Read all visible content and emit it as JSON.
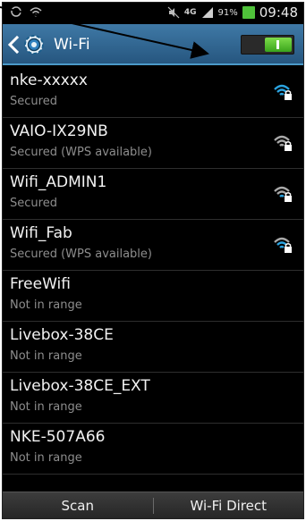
{
  "status_bar": {
    "network_type": "4G",
    "battery_percent": "91%",
    "time": "09:48",
    "icons": [
      "signal-icon",
      "wifi-status-icon",
      "mute-icon",
      "battery-icon"
    ]
  },
  "action_bar": {
    "title": "Wi-Fi",
    "toggle_on": true
  },
  "networks": [
    {
      "name": "nke-xxxxx",
      "status": "Secured",
      "signal_active": true
    },
    {
      "name": "VAIO-IX29NB",
      "status": "Secured (WPS available)",
      "signal_active": false
    },
    {
      "name": "Wifi_ADMIN1",
      "status": "Secured",
      "signal_active": false
    },
    {
      "name": "Wifi_Fab",
      "status": "Secured (WPS available)",
      "signal_active": true
    },
    {
      "name": "FreeWifi",
      "status": "Not in range"
    },
    {
      "name": "Livebox-38CE",
      "status": "Not in range"
    },
    {
      "name": "Livebox-38CE_EXT",
      "status": "Not in range"
    },
    {
      "name": "NKE-507A66",
      "status": "Not in range"
    }
  ],
  "bottom_bar": {
    "scan_label": "Scan",
    "wifi_direct_label": "Wi-Fi Direct"
  },
  "colors": {
    "action_bar": "#2f6a97",
    "toggle_on": "#52c12d",
    "wifi_active": "#2aa3e0",
    "wifi_inactive": "#a8a8a8"
  }
}
